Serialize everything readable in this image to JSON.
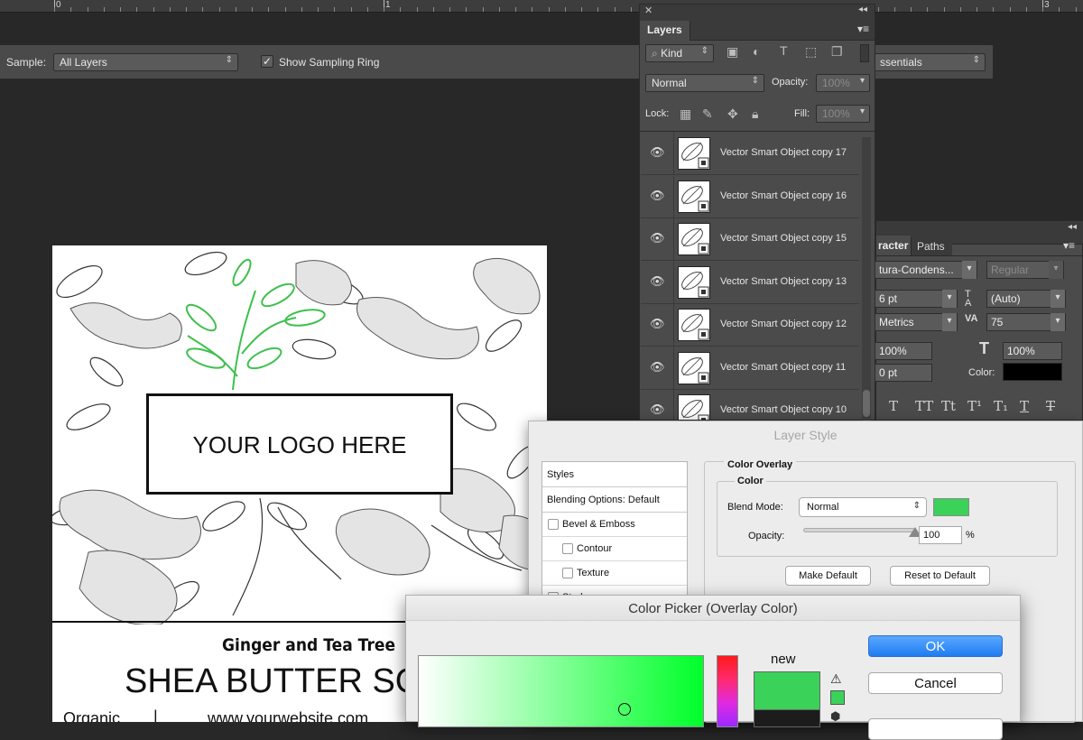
{
  "ruler": {
    "numbers": [
      "0",
      "1",
      "3"
    ]
  },
  "options_bar": {
    "sample_label": "Sample:",
    "sample_value": "All Layers",
    "show_sampling_ring_label": "Show Sampling Ring",
    "show_sampling_ring_checked": true,
    "workspace_value": "Essentials",
    "workspace_visible": "ssentials"
  },
  "layers_panel": {
    "tab_label": "Layers",
    "filter_kind": "Kind",
    "blend_mode": "Normal",
    "opacity_label": "Opacity:",
    "opacity_value": "100%",
    "lock_label": "Lock:",
    "fill_label": "Fill:",
    "fill_value": "100%",
    "layers": [
      {
        "name": "Vector Smart Object copy 17",
        "visible": true
      },
      {
        "name": "Vector Smart Object copy 16",
        "visible": true
      },
      {
        "name": "Vector Smart Object copy 15",
        "visible": true
      },
      {
        "name": "Vector Smart Object copy 13",
        "visible": true
      },
      {
        "name": "Vector Smart Object copy 12",
        "visible": true
      },
      {
        "name": "Vector Smart Object copy 11",
        "visible": true
      },
      {
        "name": "Vector Smart Object copy 10",
        "visible": true
      }
    ]
  },
  "character_panel": {
    "tab_character": "racter",
    "tab_paths": "Paths",
    "font_family": "tura-Condens...",
    "font_style": "Regular",
    "font_size": "6 pt",
    "leading": "(Auto)",
    "kerning": "Metrics",
    "tracking": "75",
    "vertical_scale": "100%",
    "horizontal_scale": "100%",
    "baseline_shift": "0 pt",
    "color_label": "Color:",
    "color_value": "#000000",
    "type_styles": [
      "T",
      "TT",
      "Tt",
      "T¹",
      "T₁",
      "T",
      "T"
    ]
  },
  "label_art": {
    "logo_text": "YOUR LOGO HERE",
    "subtitle": "Ginger and Tea Tree",
    "title": "SHEA BUTTER SO",
    "footer_left": "Organic",
    "footer_divider": "|",
    "footer_right": "www.yourwebsite.com"
  },
  "layer_style_dialog": {
    "title": "Layer Style",
    "styles_header": "Styles",
    "blending_options": "Blending Options: Default",
    "items": [
      {
        "label": "Bevel & Emboss",
        "checked": false,
        "indent": 0
      },
      {
        "label": "Contour",
        "checked": false,
        "indent": 1
      },
      {
        "label": "Texture",
        "checked": false,
        "indent": 1
      },
      {
        "label": "Stroke",
        "checked": false,
        "indent": 0
      }
    ],
    "group_title": "Color Overlay",
    "subgroup_title": "Color",
    "blend_mode_label": "Blend Mode:",
    "blend_mode_value": "Normal",
    "overlay_color": "#3bd25a",
    "opacity_label": "Opacity:",
    "opacity_value": "100",
    "opacity_unit": "%",
    "opacity_fraction": 1.0,
    "make_default": "Make Default",
    "reset_to_default": "Reset to Default"
  },
  "color_picker_dialog": {
    "title": "Color Picker (Overlay Color)",
    "ok_label": "OK",
    "cancel_label": "Cancel",
    "new_label": "new",
    "new_color": "#3bd25a",
    "current_color": "#1c1c1c",
    "hue_color": "#00ff2a"
  },
  "colors": {
    "ps_bg": "#282828",
    "ps_panel": "#4b4b4b",
    "mac_dialog": "#ececec",
    "accent_blue": "#3a8ff5",
    "leaf_green": "#3ec04e"
  }
}
